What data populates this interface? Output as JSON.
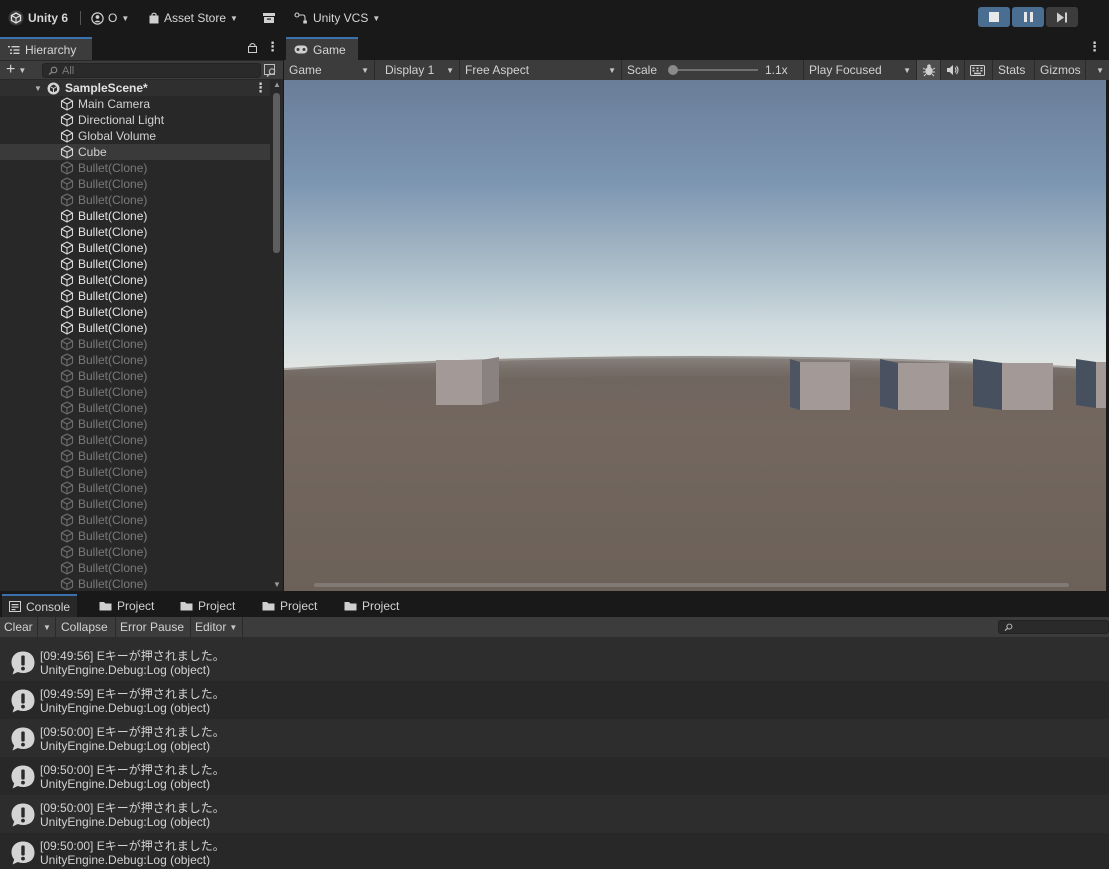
{
  "toolbar": {
    "app_label": "Unity 6",
    "account_label": "O",
    "asset_store_label": "Asset Store",
    "vcs_label": "Unity VCS"
  },
  "hierarchy": {
    "tab_label": "Hierarchy",
    "search_placeholder": "All",
    "scene_name": "SampleScene*",
    "items": [
      {
        "label": "Main Camera",
        "state": "normal"
      },
      {
        "label": "Directional Light",
        "state": "normal"
      },
      {
        "label": "Global Volume",
        "state": "normal"
      },
      {
        "label": "Cube",
        "state": "selected"
      },
      {
        "label": "Bullet(Clone)",
        "state": "dim"
      },
      {
        "label": "Bullet(Clone)",
        "state": "dim"
      },
      {
        "label": "Bullet(Clone)",
        "state": "dim"
      },
      {
        "label": "Bullet(Clone)",
        "state": "bright"
      },
      {
        "label": "Bullet(Clone)",
        "state": "bright"
      },
      {
        "label": "Bullet(Clone)",
        "state": "bright"
      },
      {
        "label": "Bullet(Clone)",
        "state": "bright"
      },
      {
        "label": "Bullet(Clone)",
        "state": "bright"
      },
      {
        "label": "Bullet(Clone)",
        "state": "bright"
      },
      {
        "label": "Bullet(Clone)",
        "state": "bright"
      },
      {
        "label": "Bullet(Clone)",
        "state": "bright"
      },
      {
        "label": "Bullet(Clone)",
        "state": "dim"
      },
      {
        "label": "Bullet(Clone)",
        "state": "dim"
      },
      {
        "label": "Bullet(Clone)",
        "state": "dim"
      },
      {
        "label": "Bullet(Clone)",
        "state": "dim"
      },
      {
        "label": "Bullet(Clone)",
        "state": "dim"
      },
      {
        "label": "Bullet(Clone)",
        "state": "dim"
      },
      {
        "label": "Bullet(Clone)",
        "state": "dim"
      },
      {
        "label": "Bullet(Clone)",
        "state": "dim"
      },
      {
        "label": "Bullet(Clone)",
        "state": "dim"
      },
      {
        "label": "Bullet(Clone)",
        "state": "dim"
      },
      {
        "label": "Bullet(Clone)",
        "state": "dim"
      },
      {
        "label": "Bullet(Clone)",
        "state": "dim"
      },
      {
        "label": "Bullet(Clone)",
        "state": "dim"
      },
      {
        "label": "Bullet(Clone)",
        "state": "dim"
      },
      {
        "label": "Bullet(Clone)",
        "state": "dim"
      },
      {
        "label": "Bullet(Clone)",
        "state": "dim"
      },
      {
        "label": "Bullet(Clone)",
        "state": "dim"
      }
    ]
  },
  "game": {
    "tab_label": "Game",
    "mode_label": "Game",
    "display_label": "Display 1",
    "aspect_label": "Free Aspect",
    "scale_label": "Scale",
    "scale_value": "1.1x",
    "play_mode_label": "Play Focused",
    "stats_label": "Stats",
    "gizmos_label": "Gizmos"
  },
  "console": {
    "tabs": [
      {
        "label": "Console",
        "icon": "console-icon",
        "active": true
      },
      {
        "label": "Project",
        "icon": "folder-icon",
        "active": false
      },
      {
        "label": "Project",
        "icon": "folder-icon",
        "active": false
      },
      {
        "label": "Project",
        "icon": "folder-icon",
        "active": false
      },
      {
        "label": "Project",
        "icon": "folder-icon",
        "active": false
      }
    ],
    "clear_label": "Clear",
    "collapse_label": "Collapse",
    "error_pause_label": "Error Pause",
    "editor_label": "Editor",
    "logs": [
      {
        "time": "[09:49:56]",
        "message": "Eキーが押されました。",
        "source": "UnityEngine.Debug:Log (object)"
      },
      {
        "time": "[09:49:59]",
        "message": "Eキーが押されました。",
        "source": "UnityEngine.Debug:Log (object)"
      },
      {
        "time": "[09:50:00]",
        "message": "Eキーが押されました。",
        "source": "UnityEngine.Debug:Log (object)"
      },
      {
        "time": "[09:50:00]",
        "message": "Eキーが押されました。",
        "source": "UnityEngine.Debug:Log (object)"
      },
      {
        "time": "[09:50:00]",
        "message": "Eキーが押されました。",
        "source": "UnityEngine.Debug:Log (object)"
      },
      {
        "time": "[09:50:00]",
        "message": "Eキーが押されました。",
        "source": "UnityEngine.Debug:Log (object)"
      }
    ]
  },
  "colors": {
    "accent": "#3a72b0",
    "play_active": "#4a6d92"
  }
}
